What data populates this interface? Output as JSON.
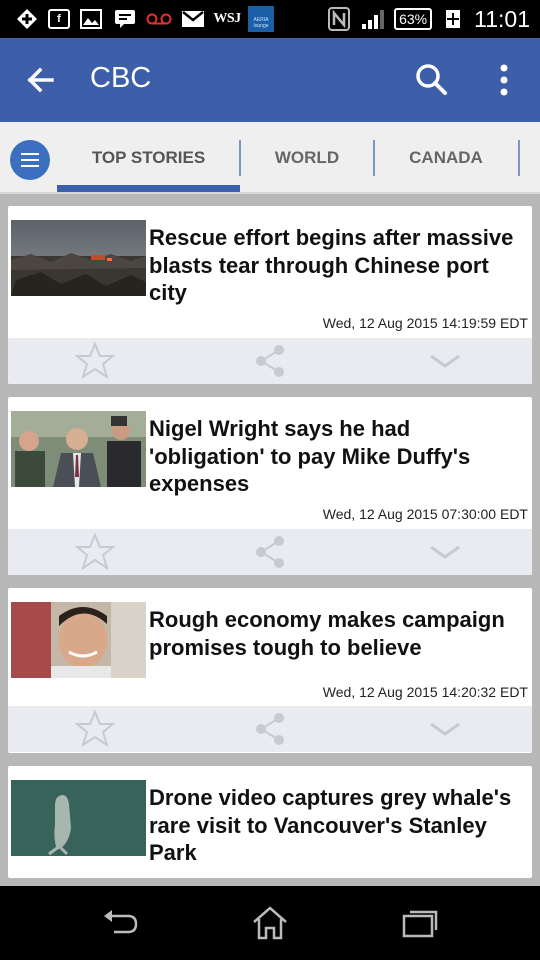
{
  "status_bar": {
    "wsj": "WSJ",
    "aircard": "AERIA lounge",
    "battery": "63%",
    "time": "11:01"
  },
  "app_bar": {
    "title": "CBC"
  },
  "tabs": [
    {
      "label": "TOP STORIES",
      "active": true
    },
    {
      "label": "WORLD",
      "active": false
    },
    {
      "label": "CANADA",
      "active": false
    }
  ],
  "stories": [
    {
      "headline": "Rescue effort begins after massive blasts tear through Chinese port city",
      "date": "Wed, 12 Aug 2015 14:19:59 EDT"
    },
    {
      "headline": "Nigel Wright says he had 'obligation' to pay Mike Duffy's expenses",
      "date": "Wed, 12 Aug 2015 07:30:00 EDT"
    },
    {
      "headline": "Rough economy makes campaign promises tough to believe",
      "date": "Wed, 12 Aug 2015 14:20:32 EDT"
    },
    {
      "headline": "Drone video captures grey whale's rare visit to Vancouver's Stanley Park",
      "date": ""
    }
  ],
  "colors": {
    "app_bar": "#3d5ea8",
    "tab_indicator": "#3d5ea8",
    "menu_button": "#3d6fc0"
  }
}
